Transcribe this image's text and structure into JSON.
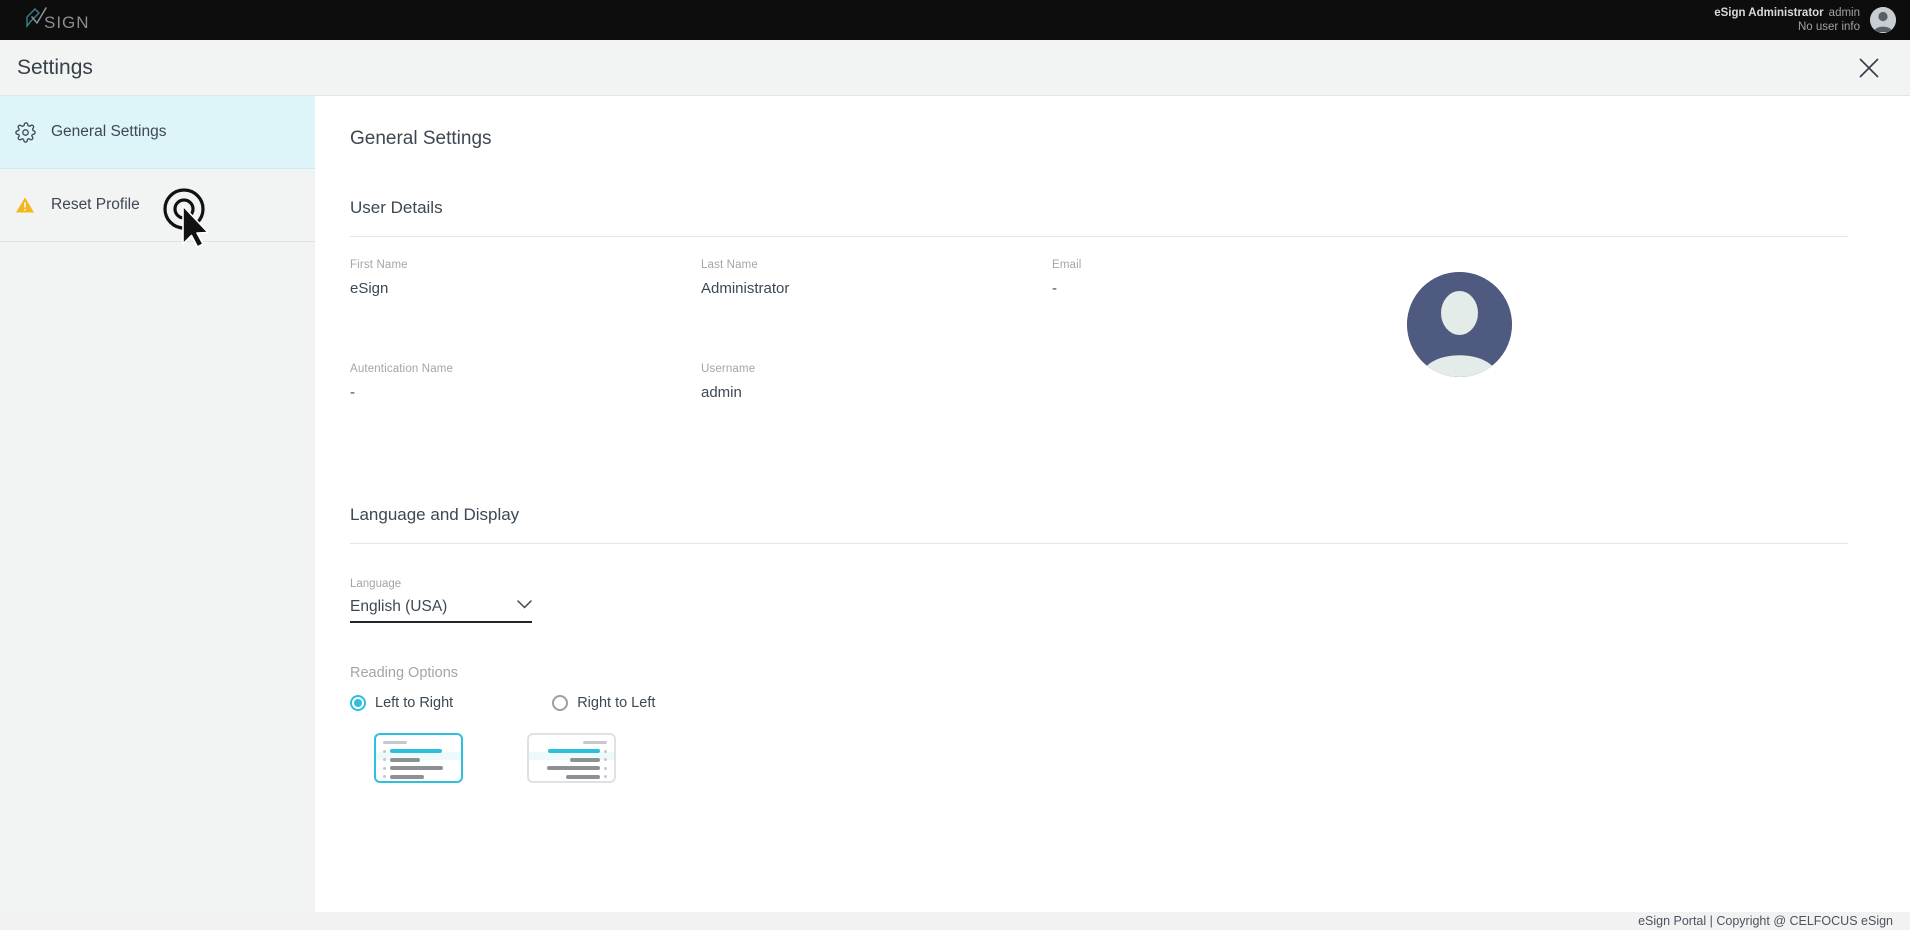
{
  "topbar": {
    "logo_text": "Sign",
    "logo_icon": "esign-pen-logo-icon",
    "user_display_name": "eSign Administrator",
    "user_account": "admin",
    "user_info": "No user info",
    "avatar_icon": "user-avatar-icon"
  },
  "header": {
    "title": "Settings",
    "close_icon": "close-icon"
  },
  "sidebar": {
    "items": [
      {
        "label": "General Settings",
        "icon": "gear-icon",
        "active": true
      },
      {
        "label": "Reset Profile",
        "icon": "warning-triangle-icon",
        "active": false
      }
    ]
  },
  "main": {
    "page_title": "General Settings",
    "user_details": {
      "section_title": "User Details",
      "fields": [
        {
          "label": "First Name",
          "value": "eSign"
        },
        {
          "label": "Last Name",
          "value": "Administrator"
        },
        {
          "label": "Email",
          "value": "-"
        },
        {
          "label": "Autentication Name",
          "value": "-"
        },
        {
          "label": "Username",
          "value": "admin"
        }
      ],
      "avatar_icon": "user-profile-avatar-icon"
    },
    "language_display": {
      "section_title": "Language and Display",
      "language_label": "Language",
      "language_value": "English (USA)",
      "dropdown_icon": "chevron-down-icon",
      "reading_options_label": "Reading Options",
      "options": [
        {
          "label": "Left to Right",
          "selected": true
        },
        {
          "label": "Right to Left",
          "selected": false
        }
      ],
      "preview_ltr_icon": "text-align-left-preview-icon",
      "preview_rtl_icon": "text-align-right-preview-icon"
    }
  },
  "footer": {
    "text": "eSign Portal | Copyright @ CELFOCUS eSign"
  },
  "colors": {
    "accent_cyan": "#2cbfde",
    "active_item_bg": "#ddf5f9",
    "topbar_bg": "#0d0d0d",
    "warning_yellow": "#f5b81c",
    "avatar_bg": "#4f5a80",
    "text_primary": "#3d4852",
    "text_muted": "#a2a5a9"
  },
  "cursor": {
    "icon": "click-cursor-indicator-icon"
  }
}
